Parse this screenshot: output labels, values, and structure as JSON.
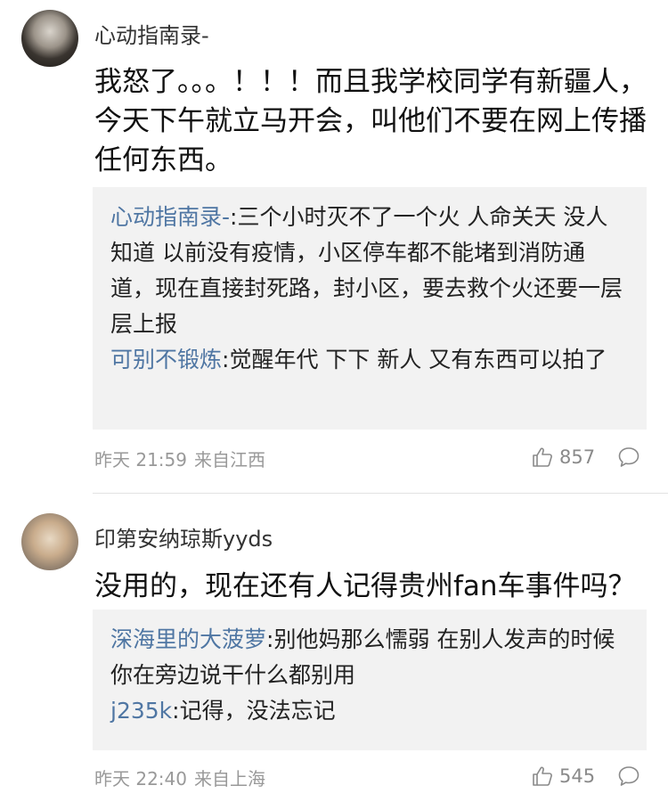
{
  "comments": [
    {
      "username": "心动指南录-",
      "text": "我怒了。。。！！！而且我学校同学有新疆人，今天下午就立马开会，叫他们不要在网上传播任何东西。",
      "replies": [
        {
          "user": "心动指南录-",
          "text": ":三个小时灭不了一个火 人命关天 没人知道 以前没有疫情，小区停车都不能堵到消防通道，现在直接封死路，封小区，要去救个火还要一层层上报"
        },
        {
          "user": "可别不锻炼",
          "text": ":觉醒年代 下下 新人 又有东西可以拍了"
        }
      ],
      "time": "昨天 21:59",
      "location": "来自江西",
      "likes": "857"
    },
    {
      "username": "印第安纳琼斯yyds",
      "text": "没用的，现在还有人记得贵州fan车事件吗？",
      "replies": [
        {
          "user": "深海里的大菠萝",
          "text": ":别他妈那么懦弱 在别人发声的时候你在旁边说干什么都别用"
        },
        {
          "user": "j235k",
          "text": ":记得，没法忘记"
        }
      ],
      "time": "昨天 22:40",
      "location": "来自上海",
      "likes": "545"
    }
  ],
  "colors": {
    "reply_user": "#4f76a3",
    "reply_bg": "#f2f2f2",
    "meta": "#999999"
  },
  "icons": [
    "thumbs-up-icon",
    "comment-bubble-icon"
  ]
}
